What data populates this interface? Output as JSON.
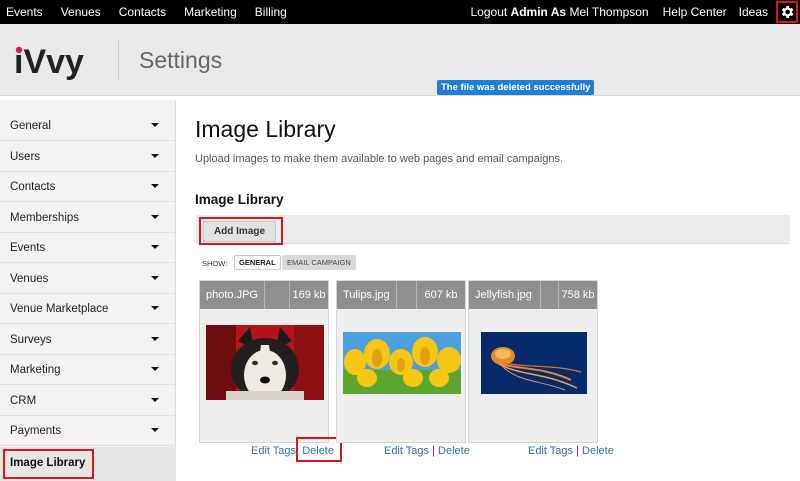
{
  "topnav": {
    "left_items": [
      "Events",
      "Venues",
      "Contacts",
      "Marketing",
      "Billing"
    ],
    "logout_prefix": "Logout",
    "admin_as": "Admin As",
    "user_name": "Mel Thompson",
    "help": "Help Center",
    "ideas": "Ideas"
  },
  "header": {
    "title": "Settings",
    "toast": "The file was deleted successfully"
  },
  "logo": {
    "text": "iVvy"
  },
  "sidebar": {
    "items": [
      "General",
      "Users",
      "Contacts",
      "Memberships",
      "Events",
      "Venues",
      "Venue Marketplace",
      "Surveys",
      "Marketing",
      "CRM",
      "Payments"
    ],
    "active": "Image Library"
  },
  "main": {
    "title": "Image Library",
    "description": "Upload images to make them available to web pages and email campaigns.",
    "section_title": "Image Library",
    "add_image": "Add Image",
    "show_label": "SHOW:",
    "filters": [
      "GENERAL",
      "EMAIL CAMPAIGN"
    ]
  },
  "images": [
    {
      "file": "photo.JPG",
      "size": "169 kb",
      "edit_tags": "Edit Tags",
      "delete": "Delete",
      "sep": ""
    },
    {
      "file": "Tulips.jpg",
      "size": "607 kb",
      "edit_tags": "Edit Tags",
      "delete": "Delete",
      "sep": "|"
    },
    {
      "file": "Jellyfish.jpg",
      "size": "758 kb",
      "edit_tags": "Edit Tags",
      "delete": "Delete",
      "sep": "|"
    }
  ],
  "colors": {
    "highlight": "#d9161a",
    "link": "#2b6fb6",
    "toast": "#1f7fd8",
    "brand_pink": "#e0176b"
  },
  "icons": {
    "settings": "gear-icon"
  }
}
